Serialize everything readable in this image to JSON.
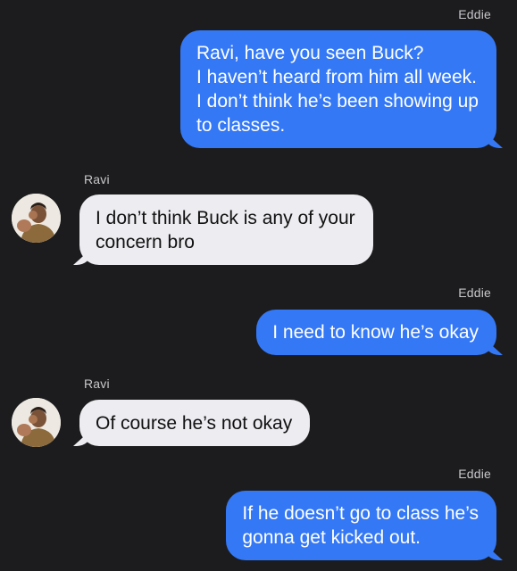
{
  "messages": [
    {
      "sender": "Eddie",
      "direction": "outgoing",
      "lines": [
        "Ravi, have you seen Buck?",
        "I haven’t heard from him all week.",
        "I don’t think he’s been showing up",
        "to classes."
      ]
    },
    {
      "sender": "Ravi",
      "direction": "incoming",
      "lines": [
        "I don’t think Buck is any of your",
        "concern bro"
      ]
    },
    {
      "sender": "Eddie",
      "direction": "outgoing",
      "lines": [
        "I need to know he’s okay"
      ]
    },
    {
      "sender": "Ravi",
      "direction": "incoming",
      "lines": [
        "Of course he’s not okay"
      ]
    },
    {
      "sender": "Eddie",
      "direction": "outgoing",
      "lines": [
        "If he doesn’t go to class he’s",
        "gonna get kicked out."
      ]
    }
  ],
  "colors": {
    "background": "#1c1c1e",
    "outgoing_bubble": "#3478f6",
    "incoming_bubble": "#ececf1"
  },
  "icons": {
    "avatar": "contact-photo-ravi"
  }
}
